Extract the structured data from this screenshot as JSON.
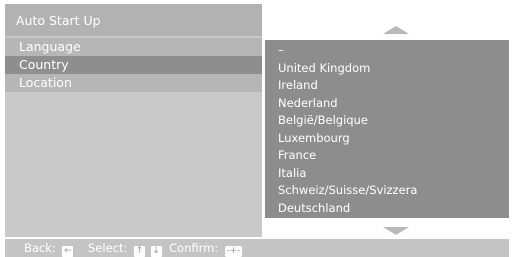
{
  "menu": {
    "title": "Auto Start Up",
    "items": [
      {
        "label": "Language",
        "selected": false
      },
      {
        "label": "Country",
        "selected": true
      },
      {
        "label": "Location",
        "selected": false
      }
    ]
  },
  "options": {
    "items": [
      "–",
      "United Kingdom",
      "Ireland",
      "Nederland",
      "België/Belgique",
      "Luxembourg",
      "France",
      "Italia",
      "Schweiz/Suisse/Svizzera",
      "Deutschland"
    ]
  },
  "footer": {
    "back_label": "Back:",
    "select_label": "Select:",
    "confirm_label": "Confirm:",
    "back_key": "←",
    "select_up_key": "↑",
    "select_down_key": "↓",
    "confirm_key": "-+-"
  },
  "colors": {
    "selected_item": "#8e8e8e",
    "options_panel": "#8d8d8d",
    "menu_panel": "#c9c9c9"
  }
}
